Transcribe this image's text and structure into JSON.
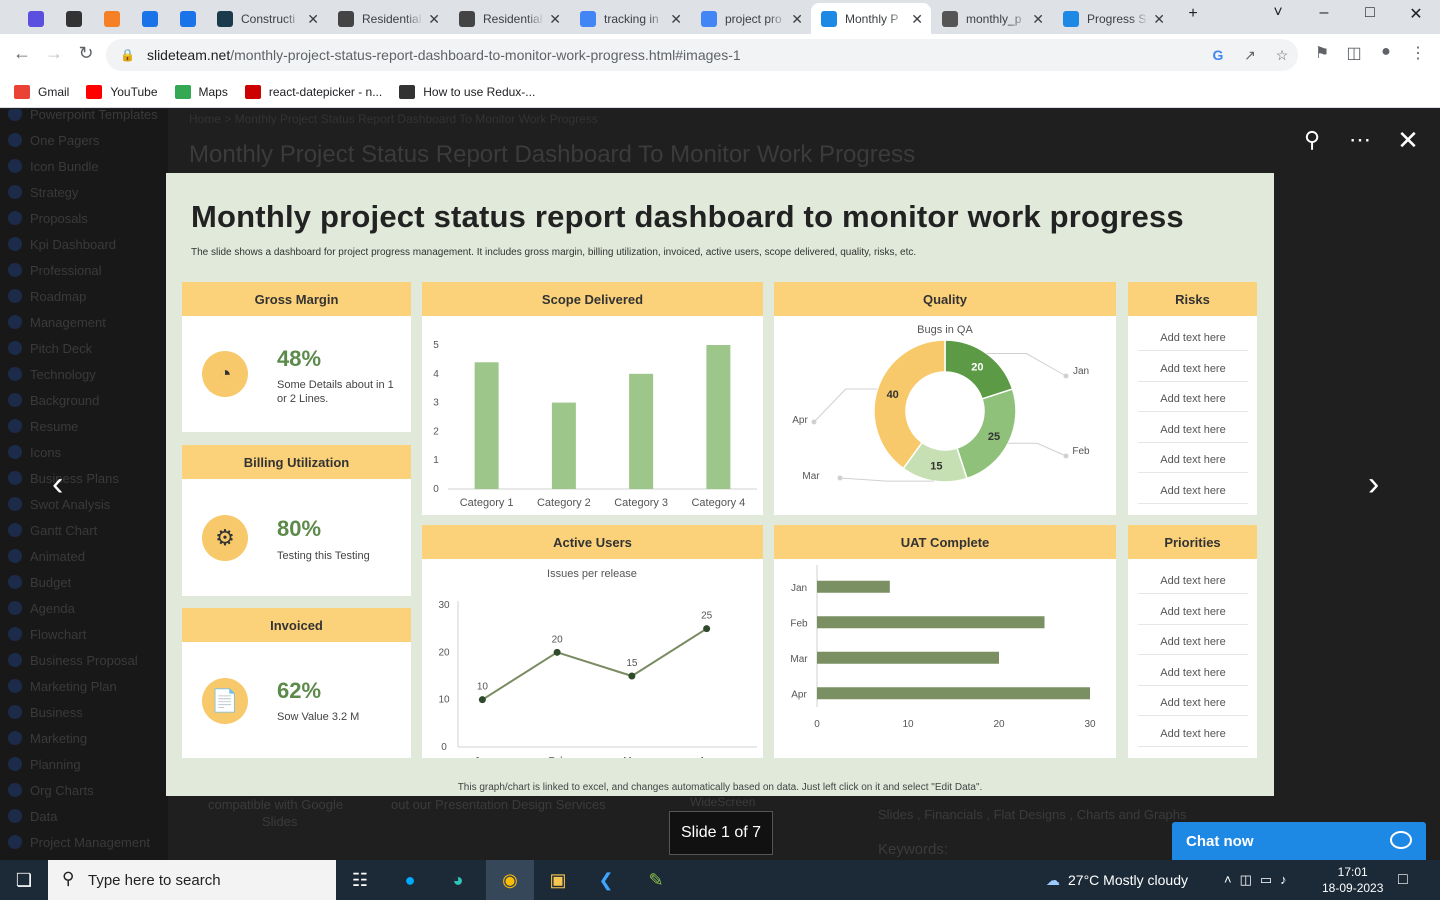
{
  "tabs": [
    {
      "label": "",
      "color": "#5b4fe0"
    },
    {
      "label": "",
      "color": "#333333"
    },
    {
      "label": "",
      "color": "#f58025"
    },
    {
      "label": "",
      "color": "#1a73e8"
    },
    {
      "label": "",
      "color": "#1a73e8"
    },
    {
      "label": "Constructi",
      "color": "#1b3a4b"
    },
    {
      "label": "Residential",
      "color": "#444444"
    },
    {
      "label": "Residential",
      "color": "#444444"
    },
    {
      "label": "tracking in",
      "color": "#4285f4"
    },
    {
      "label": "project pro",
      "color": "#4285f4"
    },
    {
      "label": "Monthly P",
      "color": "#1e88e5"
    },
    {
      "label": "monthly_p",
      "color": "#555555"
    },
    {
      "label": "Progress S",
      "color": "#1e88e5"
    }
  ],
  "url": {
    "host": "slideteam.net",
    "path": "/monthly-project-status-report-dashboard-to-monitor-work-progress.html#images-1"
  },
  "bookmarks": [
    {
      "label": "Gmail",
      "color": "#ea4335"
    },
    {
      "label": "YouTube",
      "color": "#ff0000"
    },
    {
      "label": "Maps",
      "color": "#34a853"
    },
    {
      "label": "react-datepicker - n...",
      "color": "#cc0000"
    },
    {
      "label": "How to use Redux-...",
      "color": "#333333"
    }
  ],
  "sidebar": [
    "Powerpoint Templates",
    "One Pagers",
    "Icon Bundle",
    "Strategy",
    "Proposals",
    "Kpi Dashboard",
    "Professional",
    "Roadmap",
    "Management",
    "Pitch Deck",
    "Technology",
    "Background",
    "Resume",
    "Icons",
    "Business Plans",
    "Swot Analysis",
    "Gantt Chart",
    "Animated",
    "Budget",
    "Agenda",
    "Flowchart",
    "Business Proposal",
    "Marketing Plan",
    "Business",
    "Marketing",
    "Planning",
    "Org Charts",
    "Data",
    "Project Management"
  ],
  "background": {
    "breadcrumb": "Home > Monthly Project Status Report Dashboard To Monitor Work Progress",
    "title": "Monthly Project Status Report Dashboard To Monitor Work Progress",
    "text1": "compatible with Google",
    "text1b": "Slides",
    "text2": "out our Presentation Design Services",
    "text3": "WideScreen",
    "text4": "Slides , Financials , Flat Designs , Charts and Graphs",
    "text5": "Keywords:"
  },
  "lightbox": {
    "counter": "Slide 1 of 7",
    "chat": "Chat now"
  },
  "slide": {
    "title": "Monthly project status report dashboard to monitor work progress",
    "subtitle": "The slide shows a dashboard for project progress management. It includes gross margin, billing utilization, invoiced, active users, scope delivered, quality, risks, etc.",
    "footer": "This graph/chart is linked to excel, and changes automatically based on data. Just left click on it and select \"Edit Data\".",
    "gross_margin": {
      "title": "Gross Margin",
      "value": "48%",
      "desc": "Some Details about in 1 or 2 Lines."
    },
    "billing": {
      "title": "Billing Utilization",
      "value": "80%",
      "desc": "Testing this Testing"
    },
    "invoiced": {
      "title": "Invoiced",
      "value": "62%",
      "desc": "Sow Value 3.2 M"
    },
    "scope": {
      "title": "Scope Delivered"
    },
    "quality": {
      "title": "Quality",
      "chart_title": "Bugs in QA"
    },
    "risks": {
      "title": "Risks",
      "items": [
        "Add text here",
        "Add text here",
        "Add text here",
        "Add text here",
        "Add text here",
        "Add text here"
      ]
    },
    "active": {
      "title": "Active Users",
      "chart_title": "Issues per release"
    },
    "uat": {
      "title": "UAT Complete"
    },
    "priorities": {
      "title": "Priorities",
      "items": [
        "Add text here",
        "Add text here",
        "Add text here",
        "Add text here",
        "Add text here",
        "Add text here"
      ]
    }
  },
  "chart_data": [
    {
      "type": "bar",
      "title": "Scope Delivered",
      "categories": [
        "Category 1",
        "Category 2",
        "Category 3",
        "Category 4"
      ],
      "values": [
        4.4,
        3.0,
        4.0,
        5.0
      ],
      "ylim": [
        0,
        5
      ],
      "yticks": [
        0,
        1,
        2,
        3,
        4,
        5
      ],
      "color": "#9dc78a"
    },
    {
      "type": "pie",
      "title": "Bugs in QA",
      "labels": [
        "Jan",
        "Feb",
        "Mar",
        "Apr"
      ],
      "values": [
        20,
        25,
        15,
        40
      ],
      "colors": [
        "#5c9a46",
        "#8fc17a",
        "#c6e0b4",
        "#f7c96a"
      ]
    },
    {
      "type": "line",
      "title": "Issues per release",
      "categories": [
        "Jan",
        "Feb",
        "Mar",
        "Apr"
      ],
      "values": [
        10,
        20,
        15,
        25
      ],
      "ylim": [
        0,
        30
      ],
      "yticks": [
        0,
        10,
        20,
        30
      ],
      "color": "#7a8a62"
    },
    {
      "type": "bar",
      "title": "UAT Complete",
      "orientation": "horizontal",
      "categories": [
        "Jan",
        "Feb",
        "Mar",
        "Apr"
      ],
      "values": [
        8,
        25,
        20,
        30
      ],
      "xlim": [
        0,
        30
      ],
      "xticks": [
        0,
        10,
        20,
        30
      ],
      "color": "#7a8f62"
    }
  ],
  "taskbar": {
    "search": "Type here to search",
    "weather": "27°C  Mostly cloudy",
    "time": "17:01",
    "date": "18-09-2023"
  }
}
